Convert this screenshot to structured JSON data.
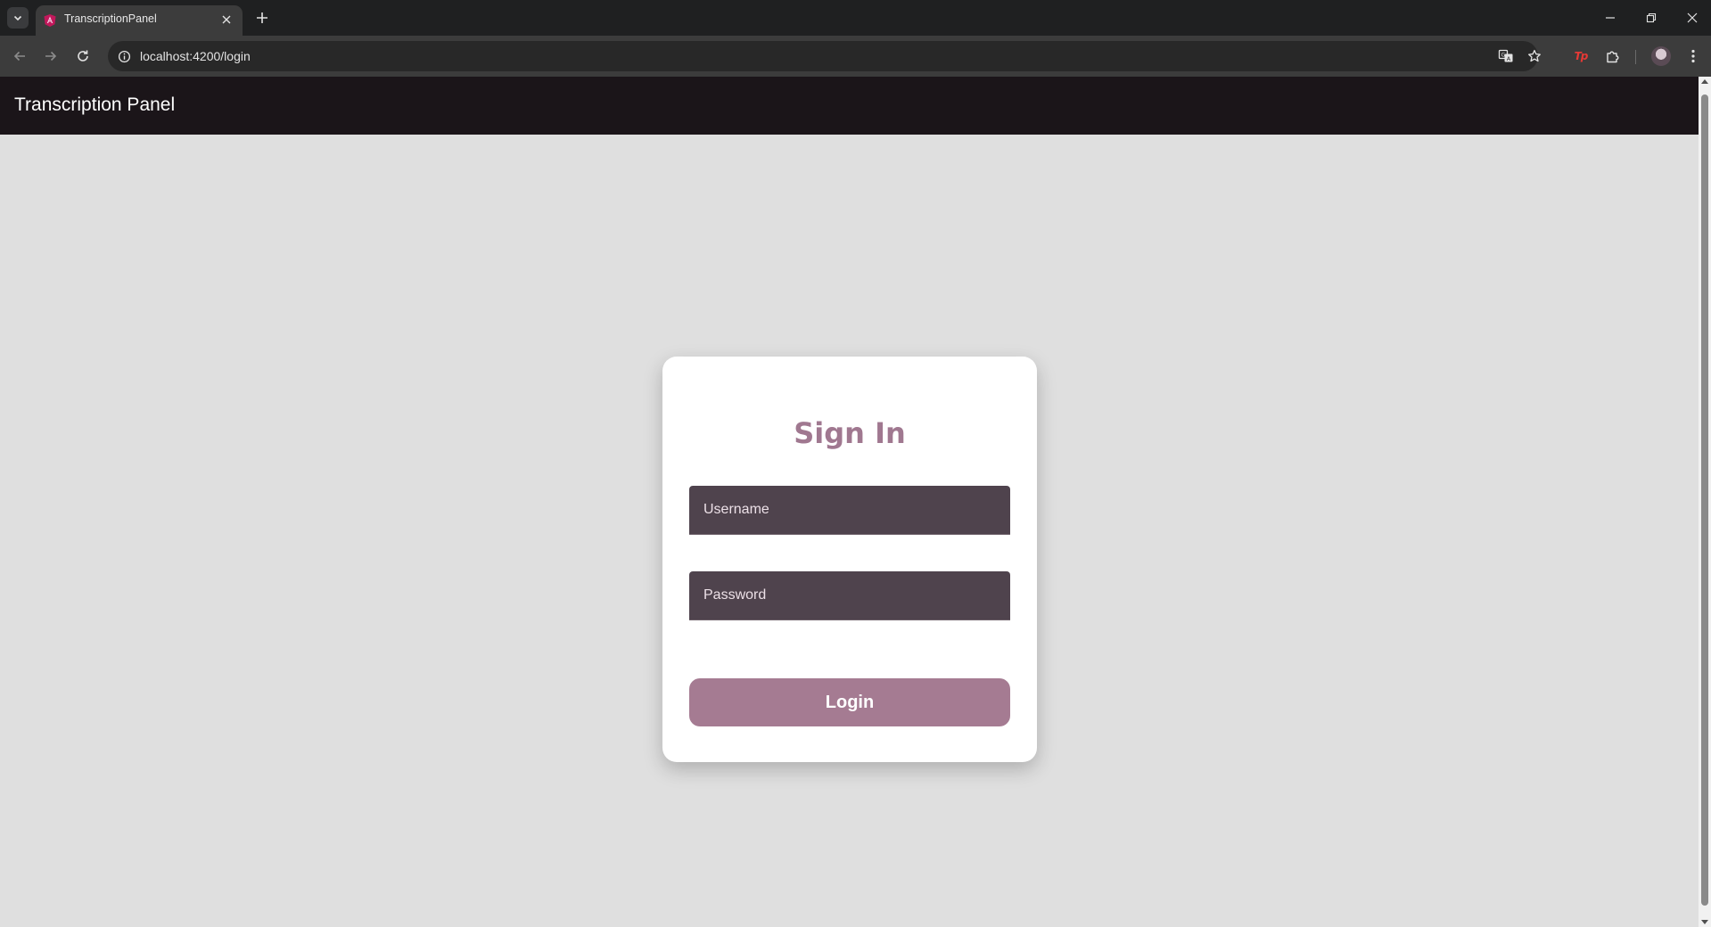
{
  "browser": {
    "tab": {
      "title": "TranscriptionPanel",
      "favicon": "angular-icon"
    },
    "url": "localhost:4200/login",
    "icons": {
      "tab_list": "chevron-down-icon",
      "tab_close": "close-icon",
      "new_tab": "plus-icon",
      "minimize": "minimize-icon",
      "restore": "restore-icon",
      "close": "close-icon",
      "back": "arrow-left-icon",
      "forward": "arrow-right-icon",
      "reload": "reload-icon",
      "site_info": "info-icon",
      "translate": "translate-icon",
      "bookmark": "star-icon",
      "extensions": "puzzle-icon",
      "menu": "more-vertical-icon"
    },
    "extension_label": "Tp"
  },
  "app": {
    "header_title": "Transcription Panel"
  },
  "login": {
    "heading": "Sign In",
    "username_placeholder": "Username",
    "password_placeholder": "Password",
    "button_label": "Login"
  },
  "colors": {
    "header_bg": "#1b1519",
    "page_bg": "#dfdfdf",
    "card_bg": "#ffffff",
    "heading": "#a07890",
    "field_bg": "#4f434d",
    "button_bg": "#a57b92"
  }
}
